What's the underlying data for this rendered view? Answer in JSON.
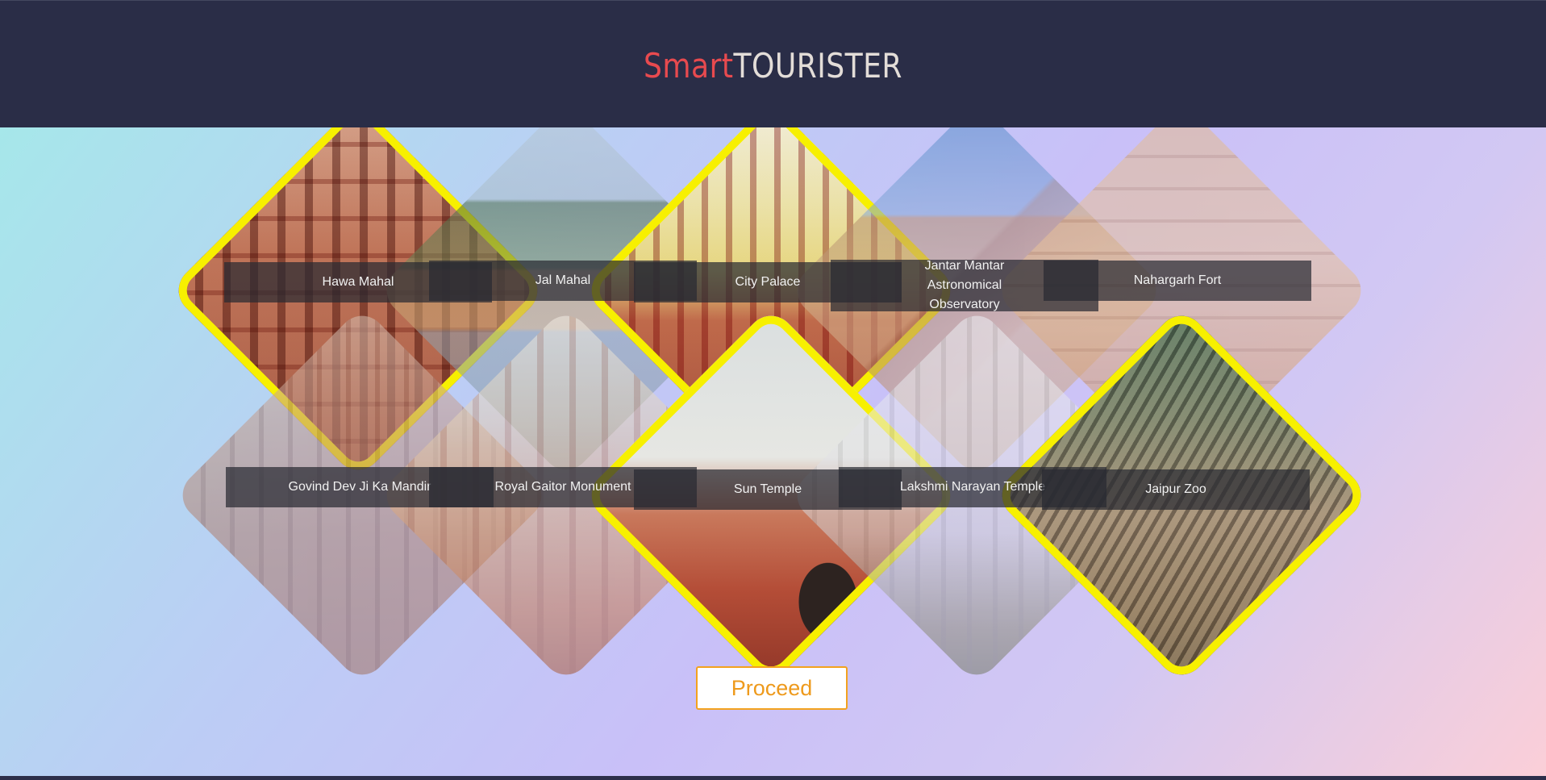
{
  "header": {
    "brand_part1": "Smart",
    "brand_part2": "TOURISTER"
  },
  "places": [
    {
      "name": "Hawa Mahal",
      "selected": true
    },
    {
      "name": "Jal Mahal",
      "selected": false
    },
    {
      "name": "City Palace",
      "selected": true
    },
    {
      "name": "Jantar Mantar Astronomical Observatory",
      "selected": false
    },
    {
      "name": "Nahargarh Fort",
      "selected": false
    },
    {
      "name": "Govind Dev Ji Ka Mandir",
      "selected": false
    },
    {
      "name": "Royal Gaitor Monument",
      "selected": false
    },
    {
      "name": "Sun Temple",
      "selected": true
    },
    {
      "name": "Lakshmi Narayan Temple",
      "selected": false
    },
    {
      "name": "Jaipur Zoo",
      "selected": true
    }
  ],
  "actions": {
    "proceed_label": "Proceed"
  },
  "colors": {
    "header_bg": "#2a2d47",
    "brand_accent": "#e84a4f",
    "selection_ring": "#f7f000",
    "proceed_accent": "#f3a21e"
  }
}
